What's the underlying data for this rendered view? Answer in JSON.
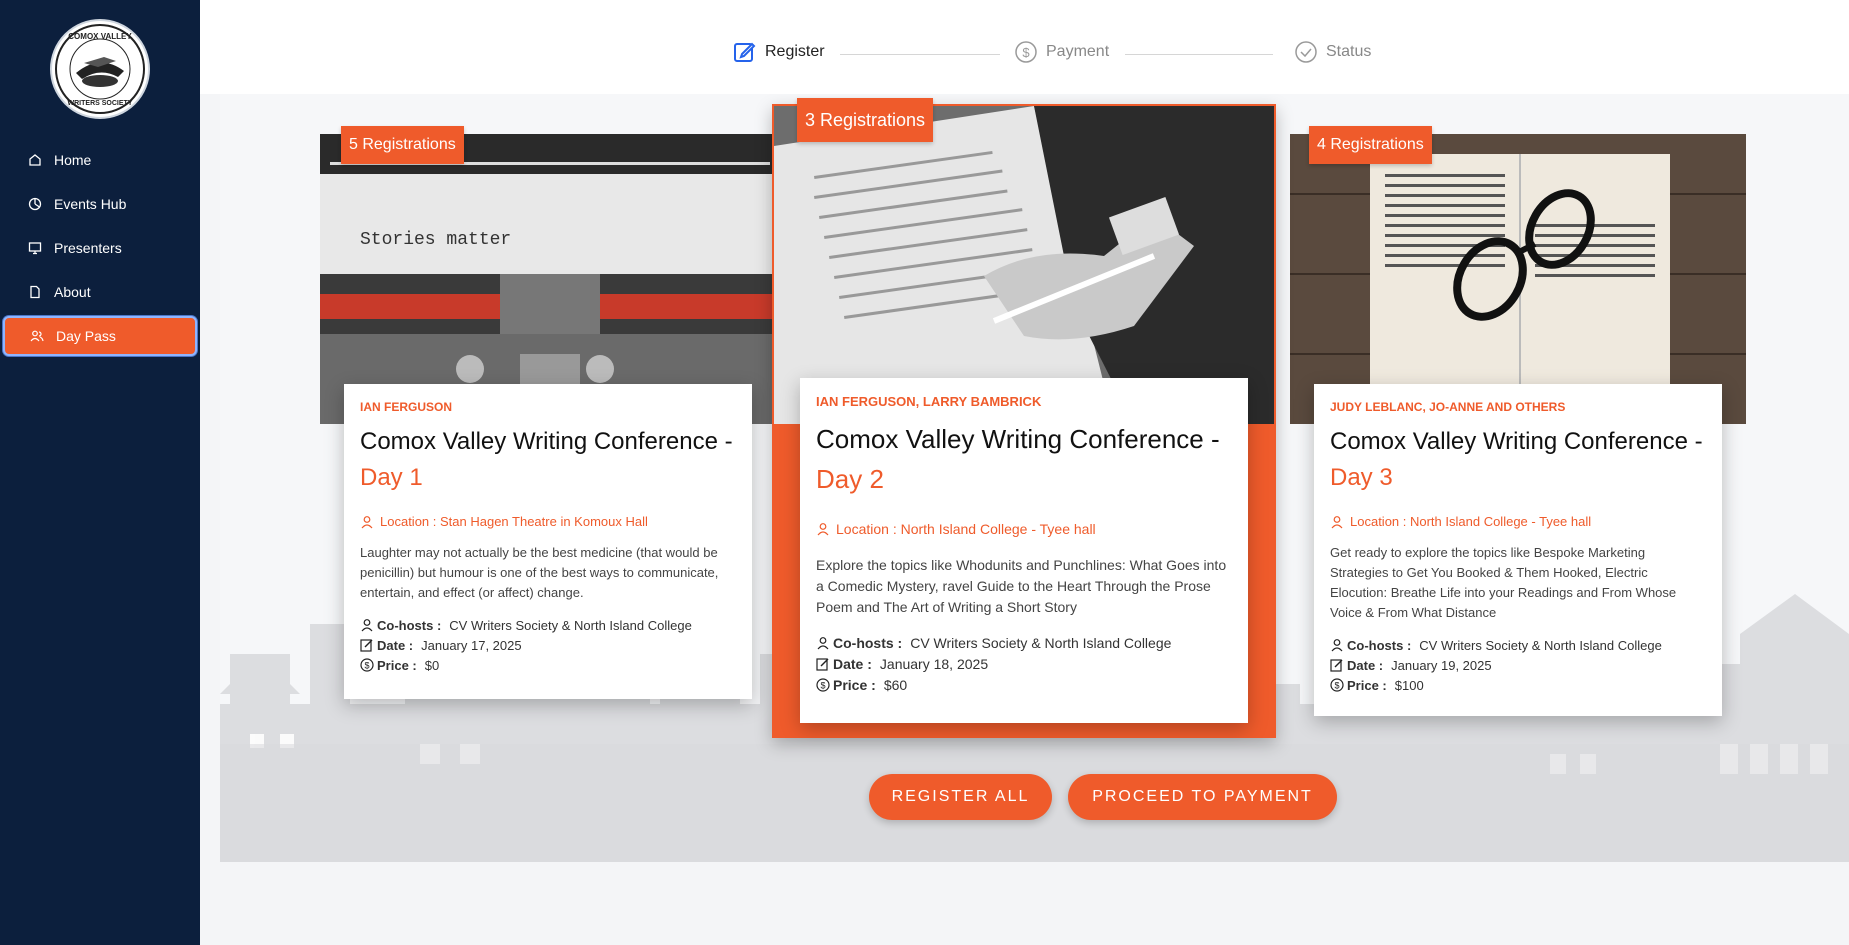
{
  "sidebar": {
    "logo_alt": "Comox Valley Writers Society",
    "items": [
      {
        "label": "Home",
        "icon": "home-icon"
      },
      {
        "label": "Events Hub",
        "icon": "chart-pie-icon"
      },
      {
        "label": "Presenters",
        "icon": "monitor-icon"
      },
      {
        "label": "About",
        "icon": "document-icon"
      },
      {
        "label": "Day Pass",
        "icon": "users-icon",
        "active": true
      }
    ]
  },
  "steps": [
    {
      "label": "Register",
      "icon": "edit-icon",
      "active": true
    },
    {
      "label": "Payment",
      "icon": "dollar-icon",
      "active": false
    },
    {
      "label": "Status",
      "icon": "check-circle-icon",
      "active": false
    }
  ],
  "cards": [
    {
      "badge": "5 Registrations",
      "presenters": "IAN FERGUSON",
      "title": "Comox Valley Writing Conference -",
      "day": "Day 1",
      "location": "Location : Stan Hagen Theatre in Komoux Hall",
      "description": "Laughter may not actually be the best medicine (that would be penicillin) but humour is one of the best ways to communicate, entertain, and effect (or affect) change.",
      "cohosts_label": "Co-hosts :",
      "cohosts": "CV Writers Society & North Island College",
      "date_label": "Date :",
      "date": "January 17, 2025",
      "price_label": "Price :",
      "price": "$0",
      "image": "typewriter-stories-matter"
    },
    {
      "badge": "3 Registrations",
      "presenters": "IAN FERGUSON, LARRY BAMBRICK",
      "title": "Comox Valley Writing Conference -",
      "day": "Day 2",
      "location": "Location : North Island College - Tyee hall",
      "description": "Explore the topics like Whodunits and Punchlines: What Goes into a Comedic Mystery, ravel Guide to the Heart Through the Prose Poem and The Art of Writing a Short Story",
      "cohosts_label": "Co-hosts :",
      "cohosts": "CV Writers Society & North Island College",
      "date_label": "Date :",
      "date": "January 18, 2025",
      "price_label": "Price :",
      "price": "$60",
      "image": "hand-writing-on-paper"
    },
    {
      "badge": "4 Registrations",
      "presenters": "JUDY LEBLANC, JO-ANNE AND OTHERS",
      "title": "Comox Valley Writing Conference -",
      "day": "Day 3",
      "location": "Location : North Island College - Tyee hall",
      "description": "Get ready to explore the topics like Bespoke Marketing Strategies to Get You Booked & Them Hooked, Electric Elocution: Breathe Life into your Readings and From Whose Voice & From What Distance",
      "cohosts_label": "Co-hosts :",
      "cohosts": "CV Writers Society & North Island College",
      "date_label": "Date :",
      "date": "January 19, 2025",
      "price_label": "Price :",
      "price": "$100",
      "image": "open-book-glasses"
    }
  ],
  "actions": {
    "register_all": "REGISTER ALL",
    "proceed": "PROCEED TO PAYMENT"
  },
  "colors": {
    "sidebar_bg": "#0c1f3d",
    "accent": "#ef5b2b",
    "active_border": "#8fb5ff"
  }
}
